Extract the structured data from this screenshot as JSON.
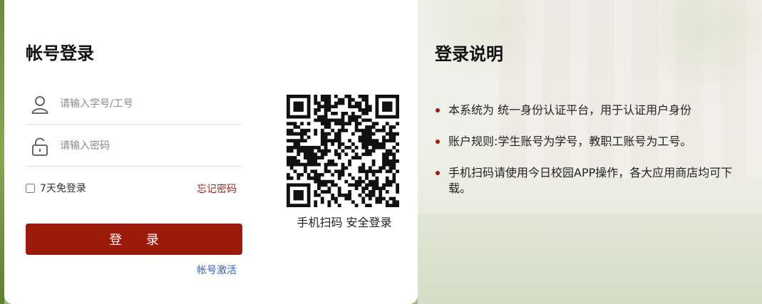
{
  "login": {
    "title": "帐号登录",
    "username_placeholder": "请输入学号/工号",
    "password_placeholder": "请输入密码",
    "remember_label": "7天免登录",
    "forgot_label": "忘记密码",
    "submit_label": "登 录",
    "activate_label": "帐号激活",
    "qr_caption": "手机扫码 安全登录",
    "icons": [
      "user-icon",
      "lock-icon",
      "qr-code-icon"
    ]
  },
  "info": {
    "title": "登录说明",
    "items": [
      "本系统为 统一身份认证平台，用于认证用户身份",
      "账户规则:学生账号为学号，教职工账号为工号。",
      "手机扫码请使用今日校园APP操作，各大应用商店均可下载。"
    ]
  },
  "colors": {
    "accent": "#9b1a0a",
    "link": "#2f5fc4",
    "forgot": "#a0271a"
  }
}
